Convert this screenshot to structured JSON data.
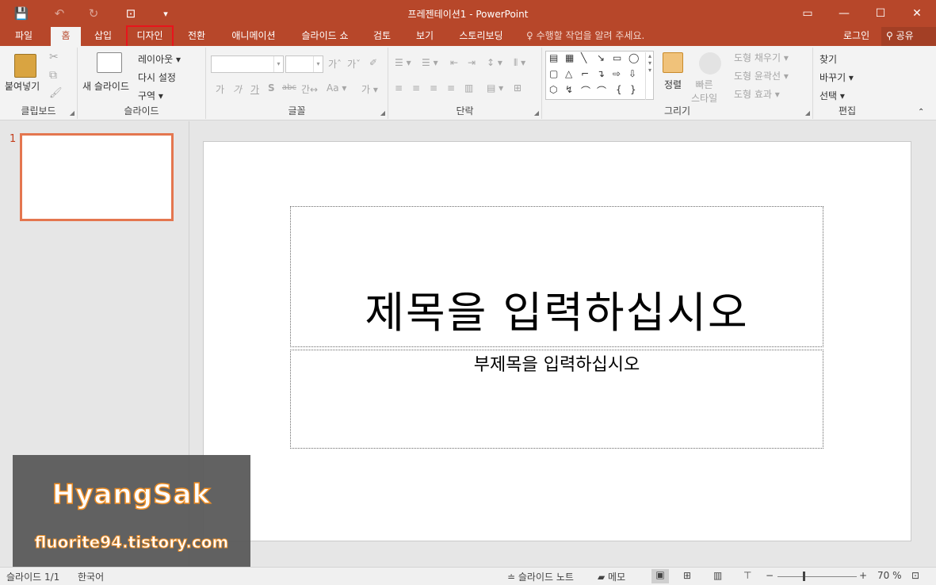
{
  "window": {
    "title": "프레젠테이션1 - PowerPoint",
    "restore_glyph": "▭",
    "min_glyph": "—",
    "max_glyph": "☐",
    "close_glyph": "✕"
  },
  "qat": {
    "save_glyph": "💾",
    "undo_glyph": "↶",
    "redo_glyph": "↻",
    "present_glyph": "⊡",
    "more_glyph": "▾"
  },
  "tabs": [
    "파일",
    "홈",
    "삽입",
    "디자인",
    "전환",
    "애니메이션",
    "슬라이드 쇼",
    "검토",
    "보기",
    "스토리보딩"
  ],
  "active_tab": "홈",
  "highlighted_tab": "디자인",
  "tell_me": "♀ 수행할 작업을 알려 주세요.",
  "account": {
    "login": "로그인",
    "share": "⚲ 공유"
  },
  "ribbon": {
    "clipboard": {
      "label": "클립보드",
      "paste": "붙여넣기",
      "cut_icon": "✂",
      "copy_icon": "⧉",
      "painter_icon": "🖌"
    },
    "slides": {
      "label": "슬라이드",
      "new_slide": "새 슬라이드",
      "layout": "레이아웃 ▾",
      "reset": "다시 설정",
      "section": "구역 ▾"
    },
    "font": {
      "label": "글꼴",
      "grow": "가ˆ",
      "shrink": "가ˇ",
      "clear": "✐",
      "row2": [
        "가",
        "가",
        "가",
        "S",
        "abc",
        "간↔",
        "Aa ▾",
        "가 ▾"
      ]
    },
    "paragraph": {
      "label": "단락",
      "row1": [
        "☰ ▾",
        "☰ ▾",
        "⇤",
        "⇥",
        "↕ ▾",
        "⦀ ▾"
      ],
      "row2": [
        "≡",
        "≡",
        "≡",
        "≡",
        "▥",
        "▤ ▾",
        "⊞"
      ]
    },
    "drawing": {
      "label": "그리기",
      "arrange": "정렬",
      "quick_styles": "빠른\n스타일",
      "fill": "도형 채우기 ▾",
      "outline": "도형 윤곽선 ▾",
      "effects": "도형 효과 ▾",
      "shapes": [
        "▤",
        "▦",
        "╲",
        "↘",
        "▭",
        "◯",
        "▢",
        "△",
        "⌐",
        "↴",
        "⇨",
        "⇩",
        "⬡",
        "↯",
        "⌒",
        "⌒",
        "{",
        "}"
      ]
    },
    "editing": {
      "label": "편집",
      "find": "찾기",
      "replace": "바꾸기 ▾",
      "select": "선택 ▾"
    }
  },
  "thumbnails": [
    {
      "number": "1"
    }
  ],
  "slide": {
    "title_placeholder": "제목을 입력하십시오",
    "subtitle_placeholder": "부제목을 입력하십시오"
  },
  "watermark": {
    "name": "HyangSak",
    "site": "fluorite94.tistory.com"
  },
  "status": {
    "slide_count": "슬라이드 1/1",
    "language": "한국어",
    "notes": "≐ 슬라이드 노트",
    "comments": "▰ 메모",
    "zoom": "70 %",
    "zoom_minus": "−",
    "zoom_plus": "+",
    "fit": "⊡"
  },
  "colors": {
    "accent": "#b7472a",
    "highlight_box": "#e8141c",
    "thumb_border": "#e4764f"
  }
}
